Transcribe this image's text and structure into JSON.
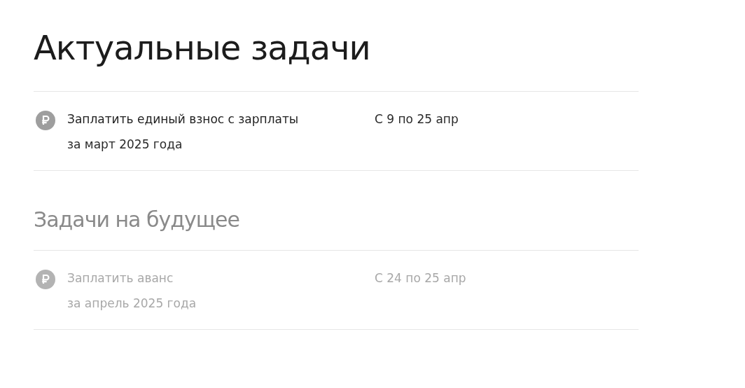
{
  "sections": [
    {
      "title": "Актуальные задачи",
      "kind": "current",
      "tasks": [
        {
          "title": "Заплатить единый взнос с зарплаты",
          "subtitle": "за март 2025 года",
          "period": "С 9 по 25 апр",
          "disabled": false
        }
      ]
    },
    {
      "title": "Задачи на будущее",
      "kind": "future",
      "tasks": [
        {
          "title": "Заплатить аванс",
          "subtitle": "за апрель 2025 года",
          "period": "С 24 по 25 апр",
          "disabled": true
        }
      ]
    }
  ]
}
